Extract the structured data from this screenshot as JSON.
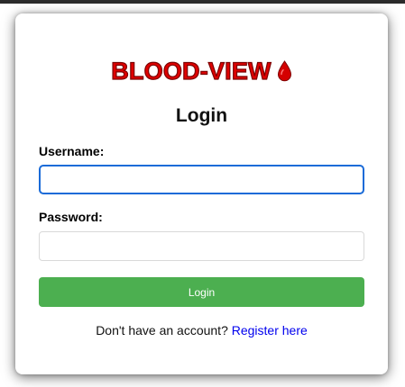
{
  "colors": {
    "brand": "#e00000",
    "primary_button": "#4caf50",
    "link": "#0000ee",
    "focus_border": "#1a6bd8"
  },
  "brand": {
    "name": "BLOOD-VIEW",
    "icon": "blood-drop-icon"
  },
  "form": {
    "title": "Login",
    "username_label": "Username:",
    "username_value": "",
    "password_label": "Password:",
    "password_value": "",
    "submit_label": "Login"
  },
  "footer": {
    "prompt": "Don't have an account?",
    "register_link": "Register here"
  }
}
